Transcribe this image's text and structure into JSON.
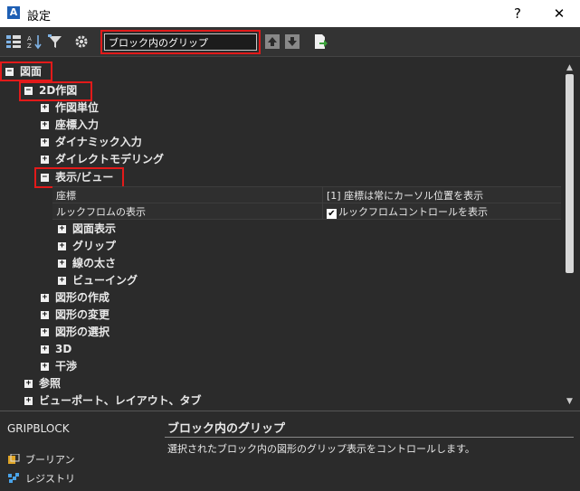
{
  "window": {
    "title": "設定",
    "help": "?",
    "close": "✕"
  },
  "search": {
    "value": "ブロック内のグリップ"
  },
  "tree": {
    "drawing": "図面",
    "draft2d": "2D作図",
    "units": "作図単位",
    "coord_input": "座標入力",
    "dynamic_input": "ダイナミック入力",
    "direct_modeling": "ダイレクトモデリング",
    "display_view": "表示/ビュー",
    "coord_prop": {
      "name": "座標",
      "value": "[1] 座標は常にカーソル位置を表示"
    },
    "lookfrom_prop": {
      "name": "ルックフロムの表示",
      "value": "ルックフロムコントロールを表示"
    },
    "drawing_display": "図面表示",
    "grips": "グリップ",
    "lineweight": "線の太さ",
    "viewing": "ビューイング",
    "create_entities": "図形の作成",
    "modify_entities": "図形の変更",
    "select_entities": "図形の選択",
    "three_d": "3D",
    "interference": "干渉",
    "reference": "参照",
    "viewports": "ビューポート、レイアウト、タブ"
  },
  "bottom": {
    "variable": "GRIPBLOCK",
    "desc_title": "ブロック内のグリップ",
    "desc_text": "選択されたブロック内の図形のグリップ表示をコントロールします。",
    "legend_boolean": "ブーリアン",
    "legend_registry": "レジストリ"
  }
}
